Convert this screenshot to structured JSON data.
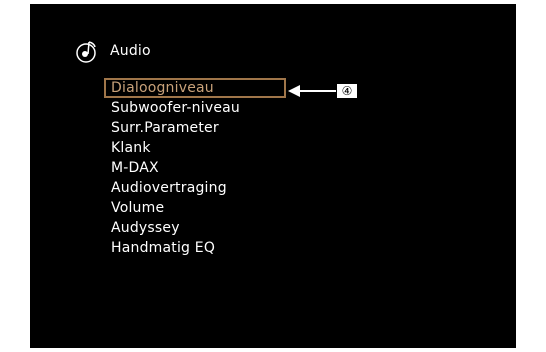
{
  "menu": {
    "icon": "audio-note-icon",
    "title": "Audio",
    "selected_index": 0,
    "items": [
      {
        "label": "Dialoogniveau"
      },
      {
        "label": "Subwoofer-niveau"
      },
      {
        "label": "Surr.Parameter"
      },
      {
        "label": "Klank"
      },
      {
        "label": "M-DAX"
      },
      {
        "label": "Audiovertraging"
      },
      {
        "label": "Volume"
      },
      {
        "label": "Audyssey"
      },
      {
        "label": "Handmatig EQ"
      }
    ]
  },
  "callout": {
    "label": "④",
    "arrow_icon": "left-arrow-icon"
  },
  "colors": {
    "screen_background": "#000000",
    "text": "#ffffff",
    "highlight_border": "#a0764a",
    "highlight_text": "#c9a27a"
  }
}
